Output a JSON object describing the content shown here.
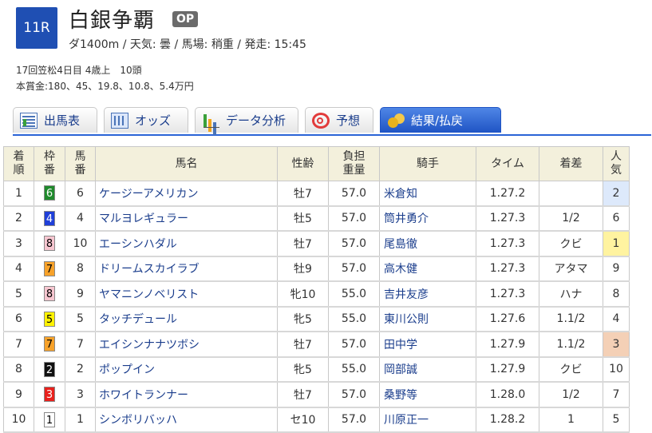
{
  "race": {
    "number": "11R",
    "title": "白銀争覇",
    "grade": "OP",
    "info": "ダ1400m / 天気: 曇 / 馬場: 稍重 / 発走: 15:45",
    "meta_line1": "17回笠松4日目 4歳上　10頭",
    "meta_line2": "本賞金:180、45、19.8、10.8、5.4万円"
  },
  "tabs": [
    {
      "label": "出馬表",
      "icon": "race-card-icon"
    },
    {
      "label": "オッズ",
      "icon": "odds-icon"
    },
    {
      "label": "データ分析",
      "icon": "chart-icon"
    },
    {
      "label": "予想",
      "icon": "target-icon"
    },
    {
      "label": "結果/払戻",
      "icon": "coins-icon",
      "active": true
    }
  ],
  "table": {
    "headers": {
      "rank": [
        "着",
        "順"
      ],
      "waku": [
        "枠",
        "番"
      ],
      "num": [
        "馬",
        "番"
      ],
      "horse": "馬名",
      "sexage": "性齢",
      "weight": [
        "負担",
        "重量"
      ],
      "jockey": "騎手",
      "time": "タイム",
      "margin": "着差",
      "pop": [
        "人",
        "気"
      ]
    },
    "rows": [
      {
        "rank": "1",
        "waku": "6",
        "num": "6",
        "horse": "ケージーアメリカン",
        "sexage": "牡7",
        "weight": "57.0",
        "jockey": "米倉知",
        "time": "1.27.2",
        "margin": "",
        "pop": "2"
      },
      {
        "rank": "2",
        "waku": "4",
        "num": "4",
        "horse": "マルヨレギュラー",
        "sexage": "牡5",
        "weight": "57.0",
        "jockey": "筒井勇介",
        "time": "1.27.3",
        "margin": "1/2",
        "pop": "6"
      },
      {
        "rank": "3",
        "waku": "8",
        "num": "10",
        "horse": "エーシンハダル",
        "sexage": "牡7",
        "weight": "57.0",
        "jockey": "尾島徹",
        "time": "1.27.3",
        "margin": "クビ",
        "pop": "1"
      },
      {
        "rank": "4",
        "waku": "7",
        "num": "8",
        "horse": "ドリームスカイラブ",
        "sexage": "牡9",
        "weight": "57.0",
        "jockey": "高木健",
        "time": "1.27.3",
        "margin": "アタマ",
        "pop": "9"
      },
      {
        "rank": "5",
        "waku": "8",
        "num": "9",
        "horse": "ヤマニンノベリスト",
        "sexage": "牝10",
        "weight": "55.0",
        "jockey": "吉井友彦",
        "time": "1.27.3",
        "margin": "ハナ",
        "pop": "8"
      },
      {
        "rank": "6",
        "waku": "5",
        "num": "5",
        "horse": "タッチデュール",
        "sexage": "牝5",
        "weight": "55.0",
        "jockey": "東川公則",
        "time": "1.27.6",
        "margin": "1.1/2",
        "pop": "4"
      },
      {
        "rank": "7",
        "waku": "7",
        "num": "7",
        "horse": "エイシンナナツボシ",
        "sexage": "牡7",
        "weight": "57.0",
        "jockey": "田中学",
        "time": "1.27.9",
        "margin": "1.1/2",
        "pop": "3"
      },
      {
        "rank": "8",
        "waku": "2",
        "num": "2",
        "horse": "ポップイン",
        "sexage": "牝5",
        "weight": "55.0",
        "jockey": "岡部誠",
        "time": "1.27.9",
        "margin": "クビ",
        "pop": "10"
      },
      {
        "rank": "9",
        "waku": "3",
        "num": "3",
        "horse": "ホワイトランナー",
        "sexage": "牡7",
        "weight": "57.0",
        "jockey": "桑野等",
        "time": "1.28.0",
        "margin": "1/2",
        "pop": "7"
      },
      {
        "rank": "10",
        "waku": "1",
        "num": "1",
        "horse": "シンボリバッハ",
        "sexage": "セ10",
        "weight": "57.0",
        "jockey": "川原正一",
        "time": "1.28.2",
        "margin": "1",
        "pop": "5"
      }
    ]
  },
  "colors": {
    "race_badge": "#1f4fb3",
    "waku": {
      "1": {
        "bg": "#ffffff",
        "fg": "#000000"
      },
      "2": {
        "bg": "#111111",
        "fg": "#ffffff"
      },
      "3": {
        "bg": "#e8201c",
        "fg": "#ffffff"
      },
      "4": {
        "bg": "#1f3fd8",
        "fg": "#ffffff"
      },
      "5": {
        "bg": "#fff200",
        "fg": "#000000"
      },
      "6": {
        "bg": "#1f8a2c",
        "fg": "#ffffff"
      },
      "7": {
        "bg": "#f7a22a",
        "fg": "#000000"
      },
      "8": {
        "bg": "#f7c6d0",
        "fg": "#000000"
      }
    },
    "pop_highlight": {
      "1": "#fff3a0",
      "2": "#dde9fb",
      "3": "#f4d0b6"
    }
  }
}
